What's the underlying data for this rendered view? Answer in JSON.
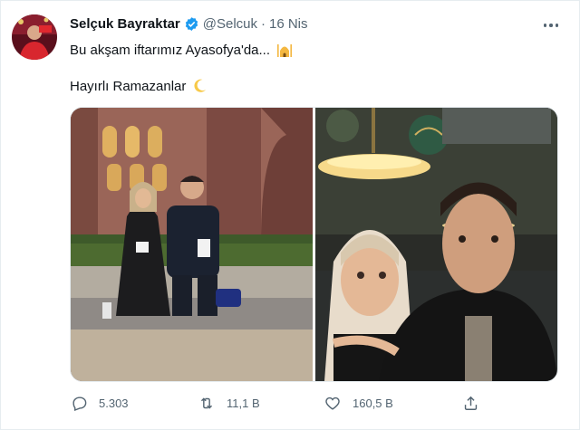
{
  "tweet": {
    "author_name": "Selçuk Bayraktar",
    "handle": "@Selcuk",
    "separator": "·",
    "date": "16 Nis",
    "text_line1": "Bu akşam iftarımız Ayasofya'da...",
    "text_line2": "Hayırlı Ramazanlar",
    "emoji1": "mosque-icon",
    "emoji2": "crescent-moon-icon"
  },
  "actions": {
    "replies": "5.303",
    "retweets": "11,1 B",
    "likes": "160,5 B"
  },
  "colors": {
    "text": "#0f1419",
    "secondary": "#536471",
    "verified": "#1d9bf0"
  }
}
